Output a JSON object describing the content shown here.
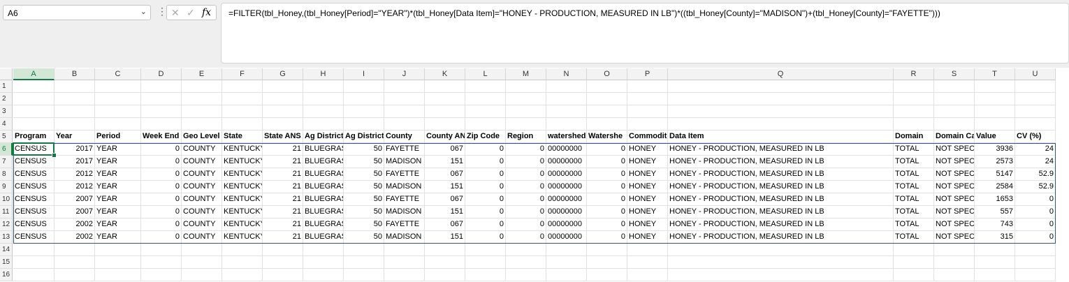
{
  "name_box": {
    "value": "A6",
    "dropdown_glyph": "⌄"
  },
  "formula_bar": {
    "cancel_glyph": "✕",
    "enter_glyph": "✓",
    "fx_glyph": "fx",
    "formula": "=FILTER(tbl_Honey,(tbl_Honey[Period]=\"YEAR\")*(tbl_Honey[Data Item]=\"HONEY - PRODUCTION, MEASURED IN LB\")*((tbl_Honey[County]=\"MADISON\")+(tbl_Honey[County]=\"FAYETTE\")))"
  },
  "columns": [
    "A",
    "B",
    "C",
    "D",
    "E",
    "F",
    "G",
    "H",
    "I",
    "J",
    "K",
    "L",
    "M",
    "N",
    "O",
    "P",
    "Q",
    "R",
    "S",
    "T",
    "U"
  ],
  "row_numbers": [
    "1",
    "2",
    "3",
    "4",
    "5",
    "6",
    "7",
    "8",
    "9",
    "10",
    "11",
    "12",
    "13",
    "14",
    "15",
    "16"
  ],
  "selected": {
    "column": "A",
    "row": "6"
  },
  "header_row": [
    "Program",
    "Year",
    "Period",
    "Week End",
    "Geo Level",
    "State",
    "State ANS",
    "Ag District",
    "Ag District",
    "County",
    "County AN",
    "Zip Code",
    "Region",
    "watershed",
    "Watershe",
    "Commodit",
    "Data Item",
    "",
    "Domain",
    "Domain Ca",
    "Value",
    "CV (%)"
  ],
  "headers": [
    "Program",
    "Year",
    "Period",
    "Week End",
    "Geo Level",
    "State",
    "State ANS",
    "Ag District",
    "Ag District",
    "County",
    "County AN",
    "Zip Code",
    "Region",
    "watershed",
    "Watershe",
    "Commodit",
    "Data Item",
    "Domain",
    "Domain Ca",
    "Value",
    "CV (%)"
  ],
  "rows": [
    [
      "CENSUS",
      "2017",
      "YEAR",
      "0",
      "COUNTY",
      "KENTUCKY",
      "21",
      "BLUEGRASS",
      "50",
      "FAYETTE",
      "067",
      "0",
      "0",
      "00000000",
      "0",
      "HONEY",
      "HONEY - PRODUCTION, MEASURED IN LB",
      "TOTAL",
      "NOT SPECI",
      "3936",
      "24"
    ],
    [
      "CENSUS",
      "2017",
      "YEAR",
      "0",
      "COUNTY",
      "KENTUCKY",
      "21",
      "BLUEGRASS",
      "50",
      "MADISON",
      "151",
      "0",
      "0",
      "00000000",
      "0",
      "HONEY",
      "HONEY - PRODUCTION, MEASURED IN LB",
      "TOTAL",
      "NOT SPECI",
      "2573",
      "24"
    ],
    [
      "CENSUS",
      "2012",
      "YEAR",
      "0",
      "COUNTY",
      "KENTUCKY",
      "21",
      "BLUEGRASS",
      "50",
      "FAYETTE",
      "067",
      "0",
      "0",
      "00000000",
      "0",
      "HONEY",
      "HONEY - PRODUCTION, MEASURED IN LB",
      "TOTAL",
      "NOT SPECI",
      "5147",
      "52.9"
    ],
    [
      "CENSUS",
      "2012",
      "YEAR",
      "0",
      "COUNTY",
      "KENTUCKY",
      "21",
      "BLUEGRASS",
      "50",
      "MADISON",
      "151",
      "0",
      "0",
      "00000000",
      "0",
      "HONEY",
      "HONEY - PRODUCTION, MEASURED IN LB",
      "TOTAL",
      "NOT SPECI",
      "2584",
      "52.9"
    ],
    [
      "CENSUS",
      "2007",
      "YEAR",
      "0",
      "COUNTY",
      "KENTUCKY",
      "21",
      "BLUEGRASS",
      "50",
      "FAYETTE",
      "067",
      "0",
      "0",
      "00000000",
      "0",
      "HONEY",
      "HONEY - PRODUCTION, MEASURED IN LB",
      "TOTAL",
      "NOT SPECI",
      "1653",
      "0"
    ],
    [
      "CENSUS",
      "2007",
      "YEAR",
      "0",
      "COUNTY",
      "KENTUCKY",
      "21",
      "BLUEGRASS",
      "50",
      "MADISON",
      "151",
      "0",
      "0",
      "00000000",
      "0",
      "HONEY",
      "HONEY - PRODUCTION, MEASURED IN LB",
      "TOTAL",
      "NOT SPECI",
      "557",
      "0"
    ],
    [
      "CENSUS",
      "2002",
      "YEAR",
      "0",
      "COUNTY",
      "KENTUCKY",
      "21",
      "BLUEGRASS",
      "50",
      "FAYETTE",
      "067",
      "0",
      "0",
      "00000000",
      "0",
      "HONEY",
      "HONEY - PRODUCTION, MEASURED IN LB",
      "TOTAL",
      "NOT SPECI",
      "743",
      "0"
    ],
    [
      "CENSUS",
      "2002",
      "YEAR",
      "0",
      "COUNTY",
      "KENTUCKY",
      "21",
      "BLUEGRASS",
      "50",
      "MADISON",
      "151",
      "0",
      "0",
      "00000000",
      "0",
      "HONEY",
      "HONEY - PRODUCTION, MEASURED IN LB",
      "TOTAL",
      "NOT SPECI",
      "315",
      "0"
    ]
  ]
}
